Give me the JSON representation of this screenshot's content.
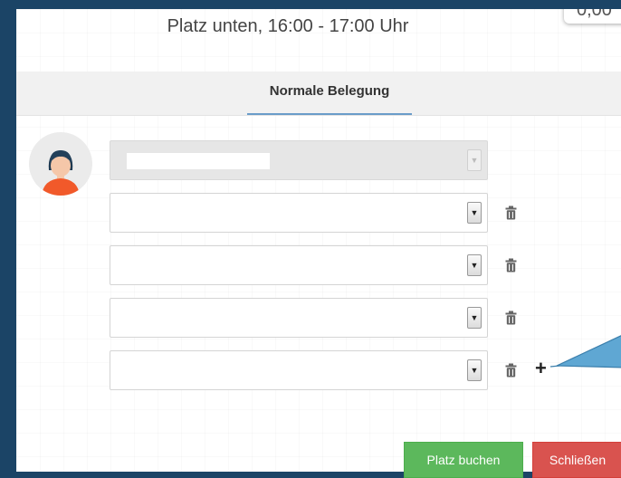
{
  "dialog": {
    "title": "Platz unten, 16:00 - 17:00 Uhr",
    "price_partial": "0,00"
  },
  "tabs": [
    {
      "label": "Normale Belegung",
      "active": true
    }
  ],
  "players": [
    {
      "selected": "",
      "disabled": true,
      "masked": true
    },
    {
      "selected": "",
      "disabled": false
    },
    {
      "selected": "",
      "disabled": false
    },
    {
      "selected": "",
      "disabled": false
    },
    {
      "selected": "",
      "disabled": false
    }
  ],
  "icons": {
    "avatar": "user-avatar-icon",
    "dropdown": "caret-down-icon",
    "delete": "trash-icon",
    "add": "plus-icon"
  },
  "buttons": {
    "book_label": "Platz buchen",
    "close_label": "Schließen"
  },
  "colors": {
    "background": "#1b4466",
    "tab_underline": "#6a9cc9",
    "book_button": "#5cb85c",
    "close_button": "#d9534f",
    "callout": "#5fa7d3"
  }
}
